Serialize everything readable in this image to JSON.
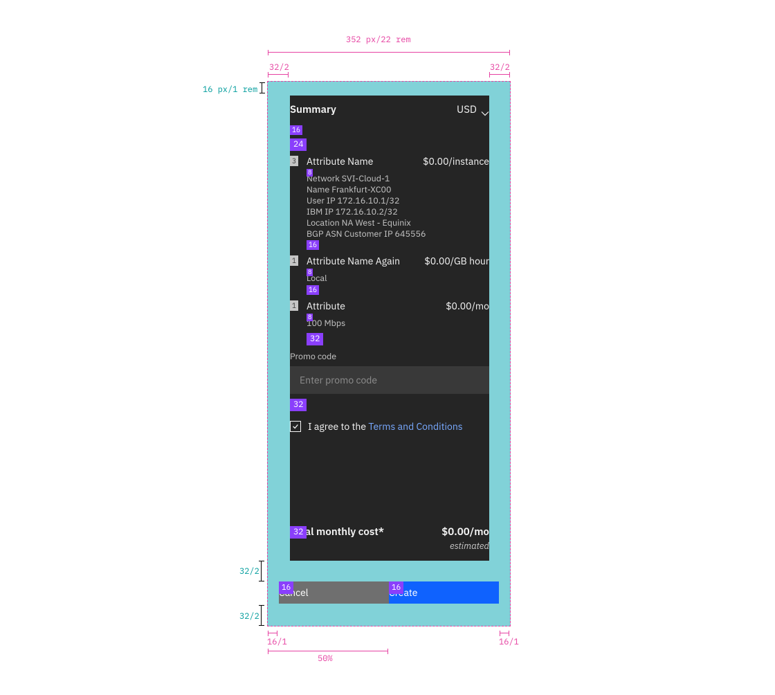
{
  "annotations": {
    "top_width": "352 px/22 rem",
    "left_height": "16 px/1 rem",
    "top_left_pad": "32/2",
    "top_right_pad": "32/2",
    "bottom_left_margin": "32/2",
    "bottom_left_margin2": "32/2",
    "bottom_left_pad": "16/1",
    "bottom_right_pad": "16/1",
    "bottom_width": "50%"
  },
  "panel": {
    "title": "Summary",
    "currency": "USD"
  },
  "tags": {
    "t16a": "16",
    "t24": "24",
    "n3": "3",
    "t8a": "8",
    "t16b": "16",
    "n1a": "1",
    "t8b": "8",
    "t16c": "16",
    "n1b": "1",
    "t8c": "8",
    "t32a": "32",
    "t32b": "32",
    "t32c": "32",
    "btn16a": "16",
    "btn16b": "16"
  },
  "attr1": {
    "name": "Attribute Name",
    "price": "$0.00/instance",
    "d1": "Network  SVI-Cloud-1",
    "d2": "Name  Frankfurt-XC00",
    "d3": "User IP  172.16.10.1/32",
    "d4": "IBM IP  172.16.10.2/32",
    "d5": "Location  NA West - Equinix",
    "d6": "BGP ASN  Customer IP 645556"
  },
  "attr2": {
    "name": "Attribute Name Again",
    "price": "$0.00/GB hour",
    "d1": "Local"
  },
  "attr3": {
    "name": "Attribute",
    "price": "$0.00/mo",
    "d1": "100 Mbps"
  },
  "promo": {
    "label": "Promo code",
    "placeholder": "Enter promo code"
  },
  "agree": {
    "prefix": "I  agree to the ",
    "link": "Terms and Conditions"
  },
  "total": {
    "label": "Total monthly cost*",
    "price": "$0.00/mo",
    "sub": "estimated"
  },
  "buttons": {
    "cancel": "Cancel",
    "create": "Create"
  }
}
